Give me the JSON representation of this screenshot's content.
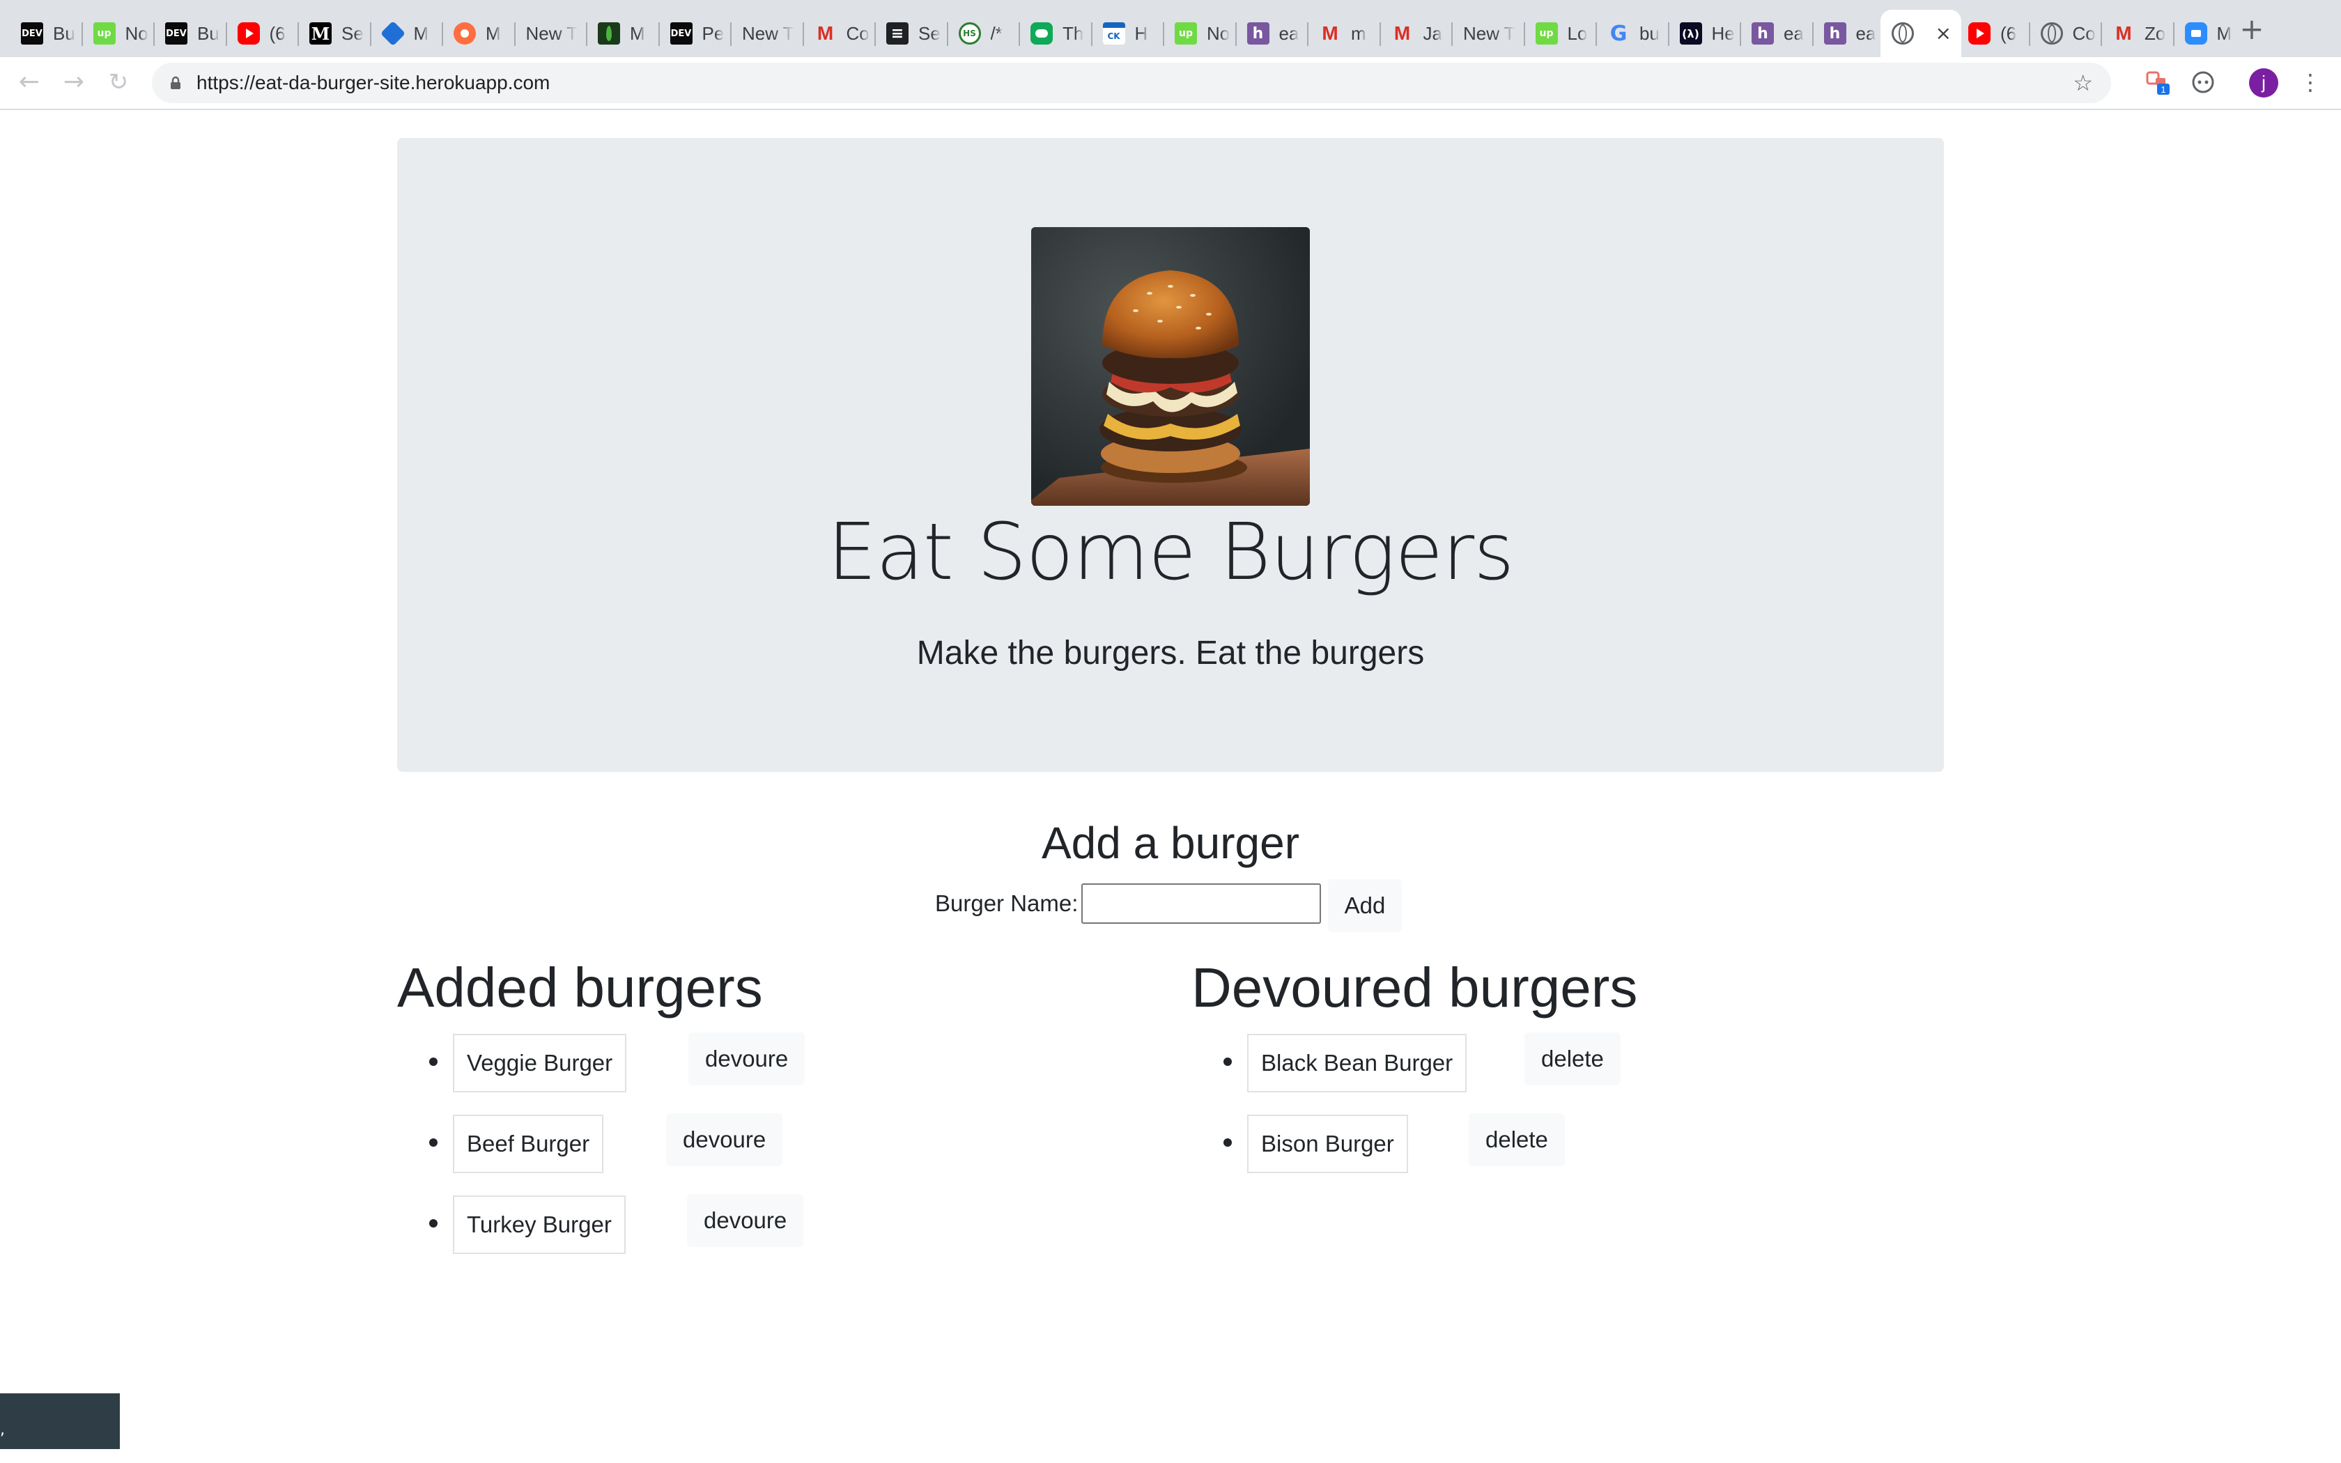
{
  "browser": {
    "tabs": [
      {
        "icon": "dev-icon",
        "favicon_text": "DEV",
        "title": "Bu"
      },
      {
        "icon": "upwork-icon",
        "favicon_text": "up",
        "title": "No"
      },
      {
        "icon": "dev-icon",
        "favicon_text": "DEV",
        "title": "Bu"
      },
      {
        "icon": "youtube-icon",
        "favicon_text": "",
        "title": "(6"
      },
      {
        "icon": "medium-icon",
        "favicon_text": "M",
        "title": "Se"
      },
      {
        "icon": "cube-icon",
        "favicon_text": "",
        "title": "M"
      },
      {
        "icon": "gitkraken-icon",
        "favicon_text": "",
        "title": "M"
      },
      {
        "icon": "",
        "favicon_text": "",
        "title": "New T"
      },
      {
        "icon": "mongodb-icon",
        "favicon_text": "",
        "title": "M"
      },
      {
        "icon": "dev-icon",
        "favicon_text": "DEV",
        "title": "Pe"
      },
      {
        "icon": "",
        "favicon_text": "",
        "title": "New T"
      },
      {
        "icon": "gmail-icon",
        "favicon_text": "M",
        "title": "Co"
      },
      {
        "icon": "list-icon",
        "favicon_text": "",
        "title": "Se"
      },
      {
        "icon": "hs-icon",
        "favicon_text": "HS",
        "title": "/*"
      },
      {
        "icon": "chat-icon",
        "favicon_text": "",
        "title": "Th"
      },
      {
        "icon": "ck-icon",
        "favicon_text": "CK",
        "title": "H"
      },
      {
        "icon": "upwork-icon",
        "favicon_text": "up",
        "title": "No"
      },
      {
        "icon": "heroku-icon",
        "favicon_text": "",
        "title": "ea"
      },
      {
        "icon": "gmail-icon",
        "favicon_text": "M",
        "title": "m"
      },
      {
        "icon": "gmail-icon",
        "favicon_text": "M",
        "title": "Ja"
      },
      {
        "icon": "",
        "favicon_text": "",
        "title": "New T"
      },
      {
        "icon": "upwork-icon",
        "favicon_text": "up",
        "title": "Lo"
      },
      {
        "icon": "google-icon",
        "favicon_text": "G",
        "title": "bu"
      },
      {
        "icon": "freecodecamp-icon",
        "favicon_text": "(λ)",
        "title": "He"
      },
      {
        "icon": "heroku-icon",
        "favicon_text": "",
        "title": "ea"
      },
      {
        "icon": "heroku-icon",
        "favicon_text": "",
        "title": "ea"
      },
      {
        "icon": "globe-icon",
        "favicon_text": "",
        "title": "",
        "active": true
      },
      {
        "icon": "youtube-icon",
        "favicon_text": "",
        "title": "(6"
      },
      {
        "icon": "globe-icon",
        "favicon_text": "",
        "title": "Co"
      },
      {
        "icon": "gmail-icon",
        "favicon_text": "M",
        "title": "Zo"
      },
      {
        "icon": "zoom-icon",
        "favicon_text": "",
        "title": "M"
      }
    ],
    "new_tab_icon": "plus-icon",
    "url": "https://eat-da-burger-site.herokuapp.com",
    "extension_badge": "1",
    "profile_initial": "j"
  },
  "page": {
    "hero": {
      "title": "Eat Some Burgers",
      "lead": "Make the burgers. Eat the burgers"
    },
    "add_form": {
      "heading": "Add a burger",
      "label": "Burger Name:",
      "input_value": "",
      "button": "Add"
    },
    "added": {
      "heading": "Added burgers",
      "action_label": "devoure",
      "items": [
        "Veggie Burger",
        "Beef Burger",
        "Turkey Burger"
      ]
    },
    "devoured": {
      "heading": "Devoured burgers",
      "action_label": "delete",
      "items": [
        "Black Bean Burger",
        "Bison Burger"
      ]
    }
  }
}
